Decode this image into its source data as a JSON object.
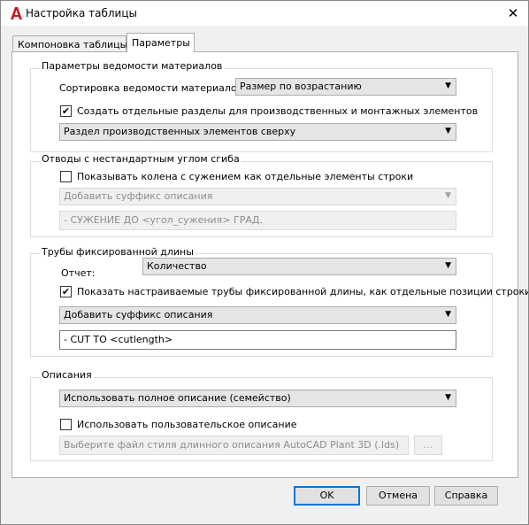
{
  "window": {
    "title": "Настройка таблицы",
    "close_glyph": "✕"
  },
  "tabs": [
    {
      "label": "Компоновка таблицы",
      "active": false
    },
    {
      "label": "Параметры",
      "active": true
    }
  ],
  "bom": {
    "group_title": "Параметры ведомости материалов",
    "sort_label": "Сортировка ведомости материалов:",
    "sort_value": "Размер по возрастанию",
    "separate_sections_checked": true,
    "separate_sections_label": "Создать отдельные разделы для производственных и монтажных элементов",
    "section_order_value": "Раздел производственных элементов сверху"
  },
  "bends": {
    "group_title": "Отводы с нестандартным углом сгиба",
    "show_checked": false,
    "show_label": "Показывать колена с сужением как отдельные элементы строки",
    "suffix_value": "Добавить суффикс описания",
    "suffix_text": "- СУЖЕНИЕ ДО <угол_сужения> ГРАД."
  },
  "fixed_pipes": {
    "group_title": "Трубы фиксированной длины",
    "report_label": "Отчет:",
    "report_value": "Количество",
    "show_checked": true,
    "show_label": "Показать настраиваемые трубы фиксированной длины, как отдельные позиции строки",
    "suffix_value": "Добавить суффикс описания",
    "suffix_text": "- CUT TO <cutlength>"
  },
  "descriptions": {
    "group_title": "Описания",
    "full_description_value": "Использовать полное описание (семейство)",
    "custom_checked": false,
    "custom_label": "Использовать пользовательское описание",
    "style_file_placeholder": "Выберите файл стиля длинного описания AutoCAD Plant 3D (.lds)",
    "browse_label": "..."
  },
  "buttons": {
    "ok": "OK",
    "cancel": "Отмена",
    "help": "Справка"
  },
  "colors": {
    "accent": "#0078d7",
    "app_icon": "#c7161d"
  }
}
